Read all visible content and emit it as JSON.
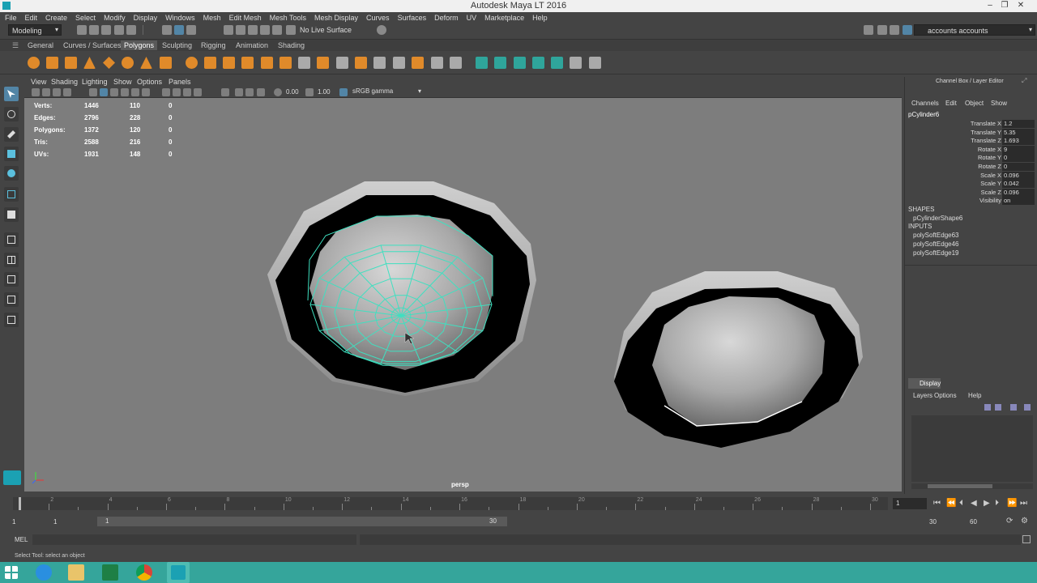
{
  "window": {
    "title": "Autodesk Maya LT 2016"
  },
  "menubar": [
    "File",
    "Edit",
    "Create",
    "Select",
    "Modify",
    "Display",
    "Windows",
    "Mesh",
    "Edit Mesh",
    "Mesh Tools",
    "Mesh Display",
    "Curves",
    "Surfaces",
    "Deform",
    "UV",
    "Marketplace",
    "Help"
  ],
  "statusline": {
    "mode": "Modeling",
    "live_surface": "No Live Surface",
    "account": "accounts accounts"
  },
  "shelf_tabs": [
    "General",
    "Curves / Surfaces",
    "Polygons",
    "Sculpting",
    "Rigging",
    "Animation",
    "Shading"
  ],
  "shelf_active": "Polygons",
  "panel_menu": [
    "View",
    "Shading",
    "Lighting",
    "Show",
    "Options",
    "Panels"
  ],
  "panel_toolbar": {
    "exposure": "0.00",
    "gamma": "1.00",
    "color_space": "sRGB gamma"
  },
  "hud": [
    {
      "label": "Verts:",
      "v1": "1446",
      "v2": "110",
      "v3": "0"
    },
    {
      "label": "Edges:",
      "v1": "2796",
      "v2": "228",
      "v3": "0"
    },
    {
      "label": "Polygons:",
      "v1": "1372",
      "v2": "120",
      "v3": "0"
    },
    {
      "label": "Tris:",
      "v1": "2588",
      "v2": "216",
      "v3": "0"
    },
    {
      "label": "UVs:",
      "v1": "1931",
      "v2": "148",
      "v3": "0"
    }
  ],
  "camera_label": "persp",
  "channel_box": {
    "header": "Channel Box / Layer Editor",
    "menu": [
      "Channels",
      "Edit",
      "Object",
      "Show"
    ],
    "object": "pCylinder6",
    "attributes": [
      {
        "name": "Translate X",
        "value": "1.2"
      },
      {
        "name": "Translate Y",
        "value": "5.35"
      },
      {
        "name": "Translate Z",
        "value": "1.693"
      },
      {
        "name": "Rotate X",
        "value": "9"
      },
      {
        "name": "Rotate Y",
        "value": "0"
      },
      {
        "name": "Rotate Z",
        "value": "0"
      },
      {
        "name": "Scale X",
        "value": "0.096"
      },
      {
        "name": "Scale Y",
        "value": "0.042"
      },
      {
        "name": "Scale Z",
        "value": "0.096"
      },
      {
        "name": "Visibility",
        "value": "on"
      }
    ],
    "shapes_label": "SHAPES",
    "shapes": [
      "pCylinderShape6"
    ],
    "inputs_label": "INPUTS",
    "inputs": [
      "polySoftEdge63",
      "polySoftEdge46",
      "polySoftEdge19"
    ]
  },
  "layer_editor": {
    "tab": "Display",
    "menu": [
      "Layers",
      "Options",
      "Help"
    ]
  },
  "time_slider": {
    "current_frame": "1",
    "tick_labels": [
      "2",
      "4",
      "6",
      "8",
      "10",
      "12",
      "14",
      "16",
      "18",
      "20",
      "22",
      "24",
      "26",
      "28",
      "30"
    ]
  },
  "range_slider": {
    "start": "1",
    "inner_start": "1",
    "slider_start": "1",
    "slider_end": "30",
    "end": "30",
    "max_end": "60"
  },
  "command_line": {
    "label": "MEL"
  },
  "help_line": {
    "text": "Select Tool: select an object"
  }
}
